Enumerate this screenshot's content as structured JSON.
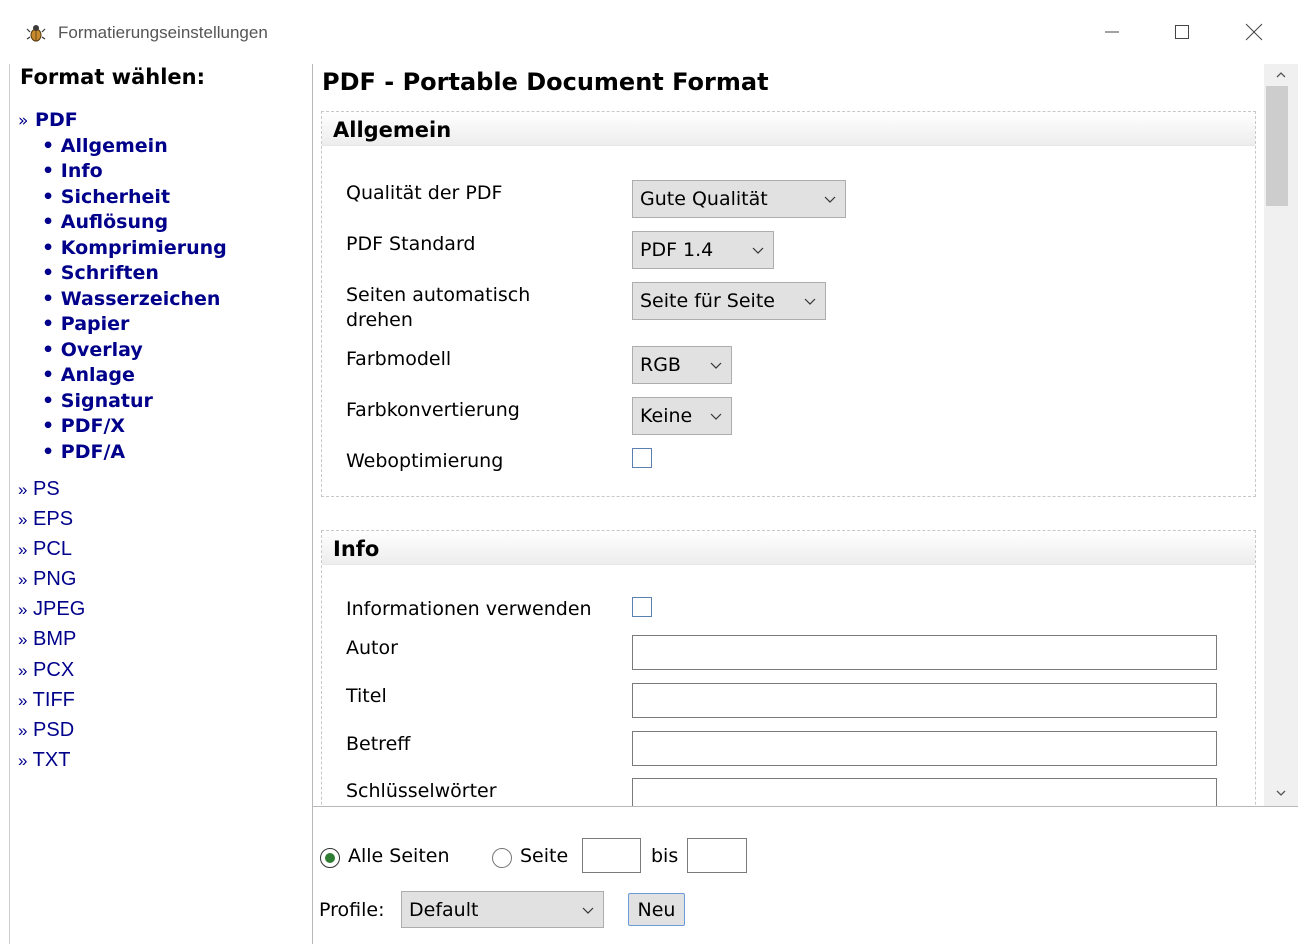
{
  "window": {
    "title": "Formatierungseinstellungen",
    "icon": "bug-app-icon"
  },
  "sidebar": {
    "heading": "Format wählen:",
    "bullet": "»",
    "dot": "•",
    "active": {
      "label": "PDF"
    },
    "sub_items": [
      {
        "label": "Allgemein"
      },
      {
        "label": "Info"
      },
      {
        "label": "Sicherheit"
      },
      {
        "label": "Auflösung"
      },
      {
        "label": "Komprimierung"
      },
      {
        "label": "Schriften"
      },
      {
        "label": "Wasserzeichen"
      },
      {
        "label": "Papier"
      },
      {
        "label": "Overlay"
      },
      {
        "label": "Anlage"
      },
      {
        "label": "Signatur"
      },
      {
        "label": "PDF/X"
      },
      {
        "label": "PDF/A"
      }
    ],
    "formats": [
      {
        "label": "PS"
      },
      {
        "label": "EPS"
      },
      {
        "label": "PCL"
      },
      {
        "label": "PNG"
      },
      {
        "label": "JPEG"
      },
      {
        "label": "BMP"
      },
      {
        "label": "PCX"
      },
      {
        "label": "TIFF"
      },
      {
        "label": "PSD"
      },
      {
        "label": "TXT"
      }
    ]
  },
  "main": {
    "title": "PDF - Portable Document Format",
    "allgemein": {
      "title": "Allgemein",
      "quality_label": "Qualität der PDF",
      "quality_value": "Gute Qualität",
      "standard_label": "PDF Standard",
      "standard_value": "PDF 1.4",
      "rotate_label_1": "Seiten automatisch",
      "rotate_label_2": "drehen",
      "rotate_value": "Seite für Seite",
      "color_model_label": "Farbmodell",
      "color_model_value": "RGB",
      "color_conv_label": "Farbkonvertierung",
      "color_conv_value": "Keine",
      "web_opt_label": "Weboptimierung"
    },
    "info": {
      "title": "Info",
      "use_info_label": "Informationen verwenden",
      "author_label": "Autor",
      "title_label": "Titel",
      "subject_label": "Betreff",
      "keywords_label": "Schlüsselwörter"
    }
  },
  "bottom": {
    "all_pages_label": "Alle Seiten",
    "page_label": "Seite",
    "to_label": "bis",
    "profile_label": "Profile:",
    "profile_value": "Default",
    "new_button": "Neu"
  },
  "colors": {
    "link": "#00008b",
    "radio_checked": "#2e7d32",
    "section_border": "#c8c8c8"
  }
}
